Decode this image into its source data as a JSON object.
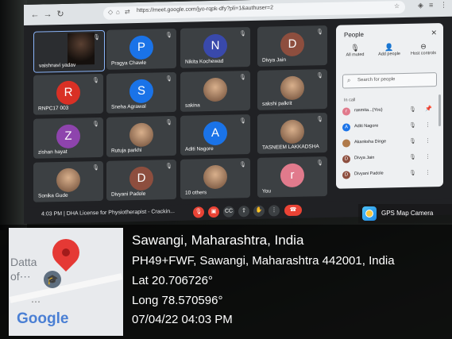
{
  "browser": {
    "url": "https://meet.google.com/jyo-rqpk-dfy?pli=1&authuser=2"
  },
  "meet": {
    "tiles": [
      {
        "name": "vaishnavi yadav",
        "initial": "",
        "color": "#2b2d30",
        "self": true
      },
      {
        "name": "Pragya Chawle",
        "initial": "P",
        "color": "#1a73e8"
      },
      {
        "name": "Nikita Kochewad",
        "initial": "N",
        "color": "#3949ab"
      },
      {
        "name": "Divya Jain",
        "initial": "D",
        "color": "#8d4e3e"
      },
      {
        "name": "RNPC17 003",
        "initial": "R",
        "color": "#d93025"
      },
      {
        "name": "Sneha Agrawal",
        "initial": "S",
        "color": "#1a73e8"
      },
      {
        "name": "sakina",
        "initial": "",
        "color": "",
        "photo": true
      },
      {
        "name": "sakshi palkrit",
        "initial": "",
        "color": "",
        "photo": true
      },
      {
        "name": "zishan hayat",
        "initial": "Z",
        "color": "#8e44ad"
      },
      {
        "name": "Rutuja parkhi",
        "initial": "",
        "color": "",
        "photo": true
      },
      {
        "name": "Aditi Nagore",
        "initial": "A",
        "color": "#1a73e8"
      },
      {
        "name": "TASNEEM LAKKADSHA",
        "initial": "",
        "color": "",
        "photo": true
      },
      {
        "name": "Sonika Gude",
        "initial": "",
        "color": "",
        "photo": true
      },
      {
        "name": "Divyani Padole",
        "initial": "D",
        "color": "#8d4e3e"
      },
      {
        "name": "10 others",
        "initial": "",
        "color": "",
        "photo": true
      },
      {
        "name": "You",
        "initial": "r",
        "color": "#e17a8c"
      }
    ],
    "bottom_bar": {
      "time_title": "4:03 PM  |  DHA License for Physiotherapist - Crackin..."
    }
  },
  "people_panel": {
    "title": "People",
    "actions": [
      {
        "label": "All muted",
        "icon": "mic-off-icon"
      },
      {
        "label": "Add people",
        "icon": "add-person-icon"
      },
      {
        "label": "Host controls",
        "icon": "toggle-icon"
      }
    ],
    "search_placeholder": "Search for people",
    "section_label": "In call",
    "participants": [
      {
        "name": "rasmita...(You)",
        "initial": "r",
        "color": "#e17a8c"
      },
      {
        "name": "Aditi Nagore",
        "initial": "A",
        "color": "#1a73e8"
      },
      {
        "name": "Akanksha Dinge",
        "initial": "",
        "color": "#b07a4a"
      },
      {
        "name": "Divya Jain",
        "initial": "D",
        "color": "#8d4e3e"
      },
      {
        "name": "Divyani Padole",
        "initial": "D",
        "color": "#8d4e3e"
      }
    ]
  },
  "gps": {
    "app_label": "GPS Map Camera",
    "place": "Sawangi, Maharashtra, India",
    "address": "PH49+FWF, Sawangi, Maharashtra 442001, India",
    "lat": "Lat 20.706726°",
    "long": "Long 78.570596°",
    "datetime": "07/04/22 04:03 PM",
    "map_label_1": "Datta",
    "map_label_2": "of⋯",
    "map_brand": "Google"
  }
}
